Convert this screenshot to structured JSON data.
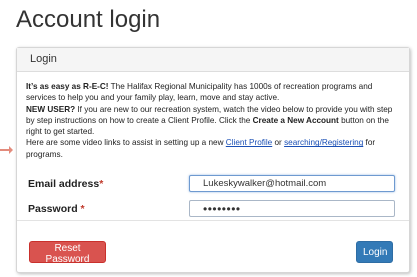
{
  "page": {
    "title": "Account login"
  },
  "panel": {
    "header": "Login",
    "intro": {
      "lead_bold": "It’s as easy as R-E-C!",
      "lead_text": " The Halifax Regional Municipality has 1000s of recreation programs and services to help you and your family play, learn, move and stay active.",
      "new_user_bold": "NEW USER?",
      "new_user_text_1": " If you are new to our recreation system, watch the video below to provide you with step by step instructions on how to create a Client Profile. Click the ",
      "create_account_bold": "Create a New Account",
      "new_user_text_2": " button on the right to get started.",
      "links_text_1": "Here are some video links to assist in setting up a new ",
      "link_client_profile": "Client Profile",
      "links_text_2": " or ",
      "link_searching": "searching/Registering",
      "links_text_3": " for programs."
    }
  },
  "form": {
    "email_label": "Email address",
    "email_value": "Lukeskywalker@hotmail.com",
    "password_label": "Password",
    "password_value": "••••••••",
    "required_marker": "*"
  },
  "buttons": {
    "reset_password": "Reset Password",
    "login": "Login"
  },
  "colors": {
    "reset_button": "#d9534f",
    "login_button": "#337ab7",
    "link": "#1a4fb5"
  }
}
